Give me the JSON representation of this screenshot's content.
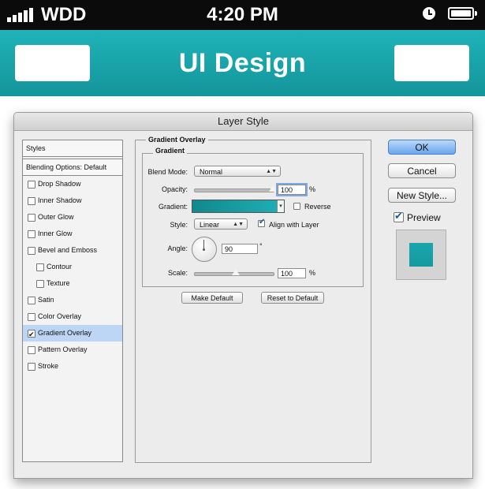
{
  "status_bar": {
    "carrier": "WDD",
    "time": "4:20 PM"
  },
  "nav_bar": {
    "title": "UI Design"
  },
  "dialog": {
    "title": "Layer Style",
    "styles_list": {
      "header": "Styles",
      "blending_options": "Blending Options: Default",
      "items": [
        {
          "label": "Drop Shadow",
          "checked": false
        },
        {
          "label": "Inner Shadow",
          "checked": false
        },
        {
          "label": "Outer Glow",
          "checked": false
        },
        {
          "label": "Inner Glow",
          "checked": false
        },
        {
          "label": "Bevel and Emboss",
          "checked": false
        },
        {
          "label": "Contour",
          "checked": false
        },
        {
          "label": "Texture",
          "checked": false
        },
        {
          "label": "Satin",
          "checked": false
        },
        {
          "label": "Color Overlay",
          "checked": false
        },
        {
          "label": "Gradient Overlay",
          "checked": true
        },
        {
          "label": "Pattern Overlay",
          "checked": false
        },
        {
          "label": "Stroke",
          "checked": false
        }
      ]
    },
    "panel": {
      "section_title": "Gradient Overlay",
      "group_title": "Gradient",
      "blend_mode": {
        "label": "Blend Mode:",
        "value": "Normal"
      },
      "opacity": {
        "label": "Opacity:",
        "value": "100",
        "unit": "%",
        "level": 100
      },
      "gradient": {
        "label": "Gradient:",
        "reverse_label": "Reverse",
        "reverse_checked": false
      },
      "style": {
        "label": "Style:",
        "value": "Linear",
        "align_label": "Align with Layer",
        "align_checked": true
      },
      "angle": {
        "label": "Angle:",
        "value": "90",
        "unit": "°"
      },
      "scale": {
        "label": "Scale:",
        "value": "100",
        "unit": "%",
        "level": 100
      },
      "make_default": "Make Default",
      "reset_default": "Reset to Default"
    },
    "buttons": {
      "ok": "OK",
      "cancel": "Cancel",
      "new_style": "New Style...",
      "preview_label": "Preview",
      "preview_checked": true
    },
    "colors": {
      "accent_teal": "#1aa6ad",
      "selection": "#bed6f6"
    }
  }
}
